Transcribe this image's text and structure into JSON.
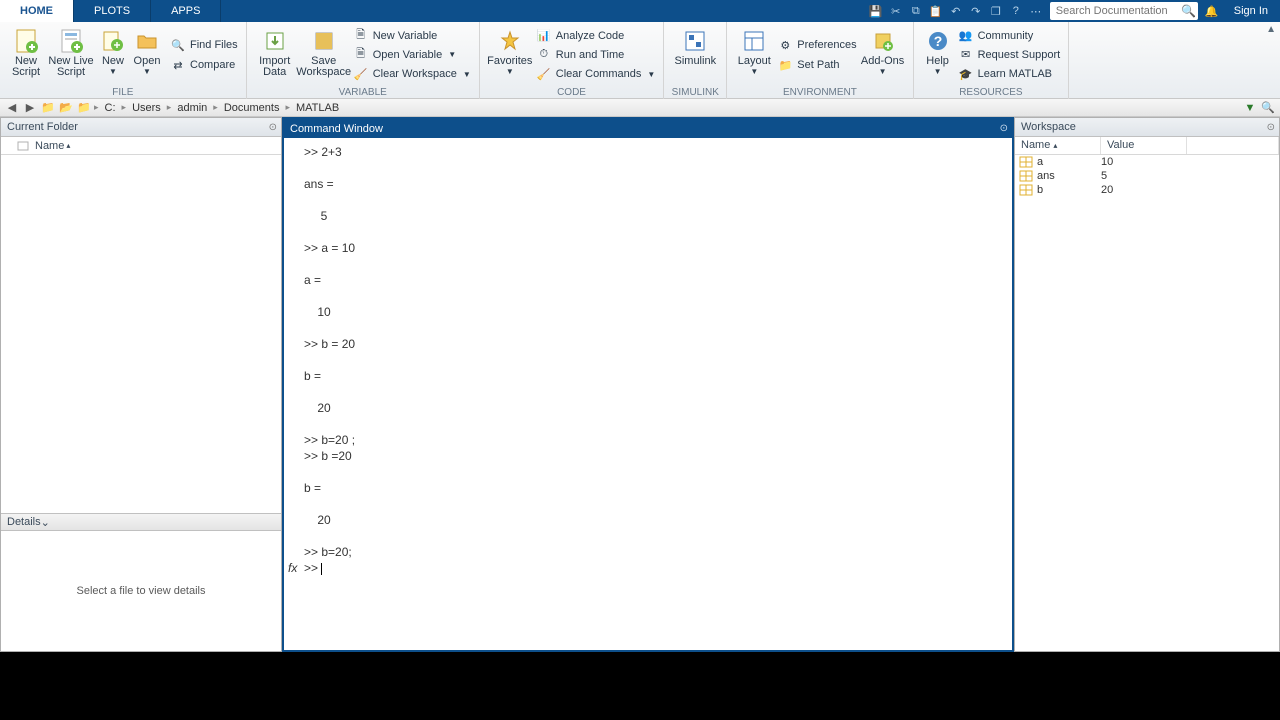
{
  "tabs": {
    "home": "HOME",
    "plots": "PLOTS",
    "apps": "APPS"
  },
  "search": {
    "placeholder": "Search Documentation"
  },
  "signin": "Sign In",
  "ribbon": {
    "file": {
      "new_script": "New\nScript",
      "new_live": "New\nLive Script",
      "new": "New",
      "open": "Open",
      "find_files": "Find Files",
      "compare": "Compare",
      "label": "FILE"
    },
    "variable": {
      "import": "Import\nData",
      "save_ws": "Save\nWorkspace",
      "new_var": "New Variable",
      "open_var": "Open Variable",
      "clear_ws": "Clear Workspace",
      "label": "VARIABLE"
    },
    "code": {
      "favorites": "Favorites",
      "analyze": "Analyze Code",
      "runtime": "Run and Time",
      "clear_cmd": "Clear Commands",
      "label": "CODE"
    },
    "simulink": {
      "simulink": "Simulink",
      "label": "SIMULINK"
    },
    "env": {
      "layout": "Layout",
      "prefs": "Preferences",
      "setpath": "Set Path",
      "addons": "Add-Ons",
      "label": "ENVIRONMENT"
    },
    "res": {
      "help": "Help",
      "community": "Community",
      "support": "Request Support",
      "learn": "Learn MATLAB",
      "label": "RESOURCES"
    }
  },
  "address": {
    "crumbs": [
      "C:",
      "Users",
      "admin",
      "Documents",
      "MATLAB"
    ]
  },
  "panels": {
    "folder_title": "Current Folder",
    "folder_col": "Name",
    "details_title": "Details",
    "details_empty": "Select a file to view details",
    "cmd_title": "Command Window",
    "ws_title": "Workspace",
    "ws_col1": "Name",
    "ws_col2": "Value"
  },
  "command_lines": [
    ">> 2+3",
    "",
    "ans =",
    "",
    "     5",
    "",
    ">> a = 10",
    "",
    "a =",
    "",
    "    10",
    "",
    ">> b = 20",
    "",
    "b =",
    "",
    "    20",
    "",
    ">> b=20 ;",
    ">> b =20",
    "",
    "b =",
    "",
    "    20",
    "",
    ">> b=20;"
  ],
  "prompt": ">> ",
  "workspace": [
    {
      "name": "a",
      "value": "10"
    },
    {
      "name": "ans",
      "value": "5"
    },
    {
      "name": "b",
      "value": "20"
    }
  ]
}
